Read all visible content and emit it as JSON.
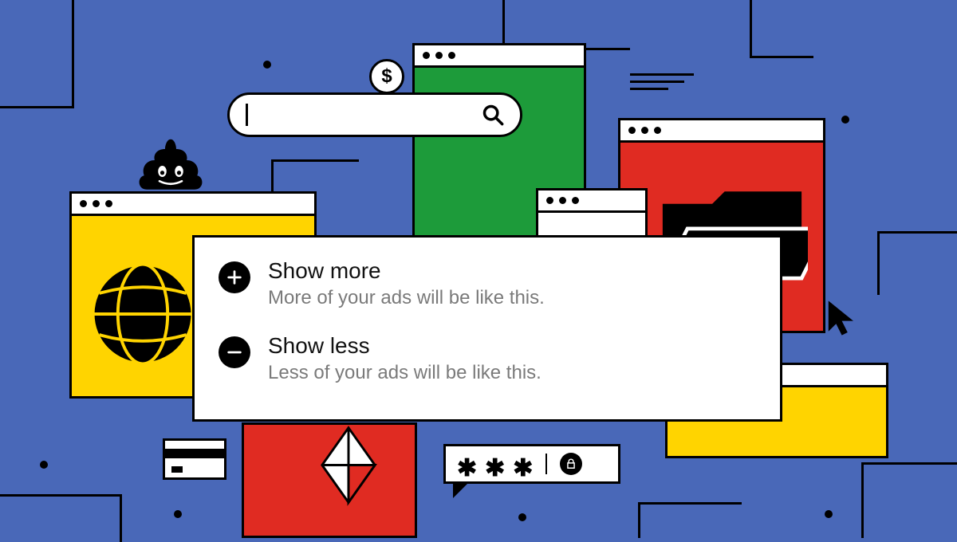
{
  "popup": {
    "show_more": {
      "title": "Show more",
      "subtitle": "More of your ads will be like this."
    },
    "show_less": {
      "title": "Show less",
      "subtitle": "Less of your ads will be like this."
    }
  },
  "search": {
    "placeholder": ""
  },
  "password": {
    "masked": "***"
  },
  "coin": {
    "symbol": "$"
  },
  "colors": {
    "blue": "#4968b8",
    "yellow": "#ffd400",
    "green": "#1d9b3a",
    "red": "#e02b22",
    "black": "#000000",
    "white": "#ffffff",
    "grey_text": "#7a7a7a"
  },
  "icons": {
    "plus": "plus-icon",
    "minus": "minus-icon",
    "search": "search-icon",
    "globe": "globe-icon",
    "lock": "lock-icon",
    "cursor": "cursor-icon",
    "dollar": "dollar-icon",
    "credit_card": "credit-card-icon",
    "poo": "poo-emoji-icon",
    "diamond": "diamond-icon",
    "folder": "folder-icon",
    "hamburger": "hamburger-icon"
  }
}
